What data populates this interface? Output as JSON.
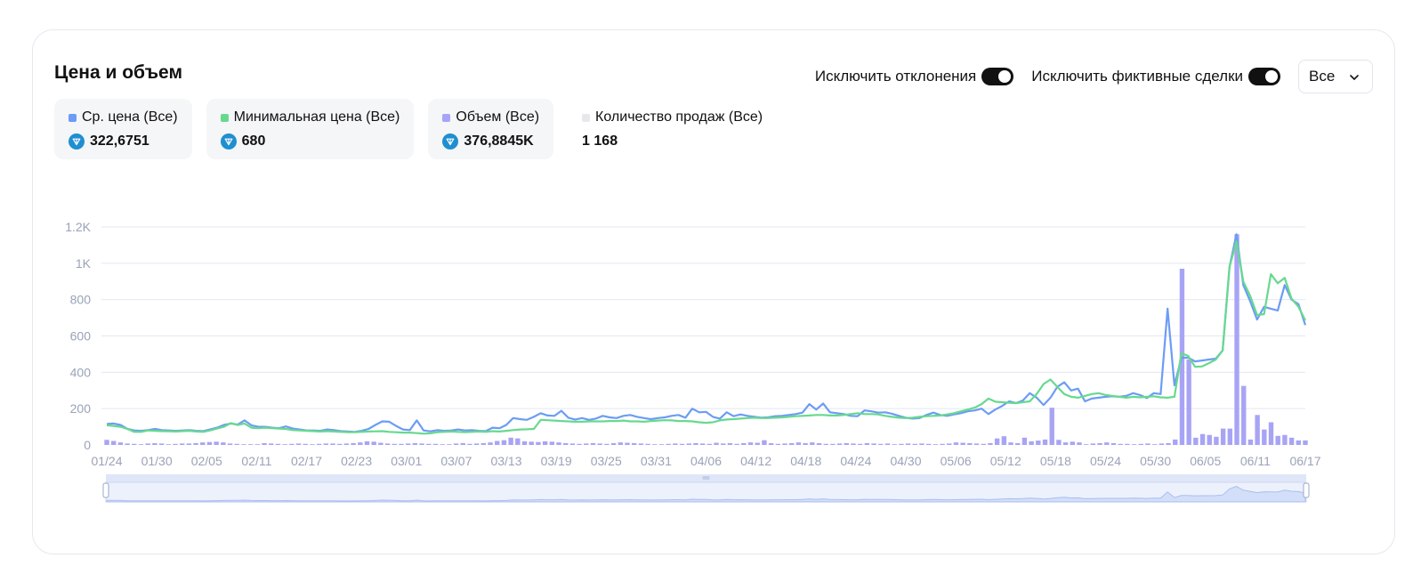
{
  "header": {
    "title": "Цена и объем"
  },
  "controls": {
    "toggle1_label": "Исключить отклонения",
    "toggle1_on": true,
    "toggle2_label": "Исключить фиктивные сделки",
    "toggle2_on": true,
    "select_value": "Все"
  },
  "stats": [
    {
      "label": "Ср. цена (Все)",
      "value": "322,6751",
      "color": "#6c9cf5",
      "icon": "ton-coin-icon"
    },
    {
      "label": "Минимальная цена (Все)",
      "value": "680",
      "color": "#67d98f",
      "icon": "ton-coin-icon"
    },
    {
      "label": "Объем (Все)",
      "value": "376,8845K",
      "color": "#a8a4f5",
      "icon": "ton-coin-icon"
    },
    {
      "label": "Количество продаж (Все)",
      "value": "1 168",
      "color": "#e8e8ec",
      "icon": ""
    }
  ],
  "colors": {
    "avg_price": "#6c9cf5",
    "min_price": "#67d98f",
    "volume": "#a8a4f5",
    "grid": "#e3e7f3",
    "axis_text": "#9aa2b8",
    "coin": "#1f8fd1"
  },
  "chart_data": {
    "type": "line",
    "ylim": [
      0,
      1200
    ],
    "y_ticks": [
      "0",
      "200",
      "400",
      "600",
      "800",
      "1K",
      "1.2K"
    ],
    "x_ticks": [
      "01/24",
      "01/30",
      "02/05",
      "02/11",
      "02/17",
      "02/23",
      "03/01",
      "03/07",
      "03/13",
      "03/19",
      "03/25",
      "03/31",
      "04/06",
      "04/12",
      "04/18",
      "04/24",
      "04/30",
      "05/06",
      "05/12",
      "05/18",
      "05/24",
      "05/30",
      "06/05",
      "06/11",
      "06/17"
    ],
    "grid": true,
    "series": [
      {
        "name": "Ср. цена (Все)",
        "kind": "line",
        "values": [
          115,
          118,
          110,
          88,
          80,
          78,
          82,
          88,
          82,
          80,
          78,
          80,
          82,
          78,
          76,
          85,
          95,
          110,
          118,
          112,
          135,
          108,
          100,
          100,
          95,
          92,
          102,
          90,
          85,
          80,
          80,
          78,
          85,
          82,
          76,
          74,
          72,
          78,
          88,
          110,
          130,
          128,
          105,
          85,
          82,
          135,
          80,
          75,
          82,
          78,
          80,
          85,
          80,
          82,
          78,
          76,
          95,
          92,
          110,
          148,
          142,
          138,
          155,
          175,
          162,
          160,
          188,
          150,
          140,
          148,
          138,
          145,
          160,
          152,
          148,
          160,
          165,
          155,
          148,
          142,
          148,
          152,
          160,
          165,
          150,
          200,
          180,
          182,
          155,
          145,
          180,
          158,
          168,
          160,
          155,
          150,
          152,
          158,
          160,
          165,
          170,
          178,
          225,
          195,
          228,
          180,
          175,
          170,
          160,
          158,
          190,
          185,
          178,
          180,
          172,
          160,
          150,
          145,
          148,
          165,
          178,
          165,
          160,
          168,
          175,
          185,
          190,
          200,
          170,
          195,
          215,
          240,
          230,
          245,
          285,
          260,
          220,
          260,
          320,
          345,
          300,
          310,
          240,
          255,
          260,
          265,
          268,
          265,
          270,
          285,
          275,
          258,
          285,
          280,
          750,
          328,
          480,
          480,
          460,
          465,
          470,
          475,
          520,
          980,
          1160,
          880,
          790,
          690,
          760,
          750,
          740,
          880,
          800,
          775,
          660
        ]
      },
      {
        "name": "Минимальная цена (Все)",
        "kind": "line",
        "values": [
          108,
          105,
          100,
          88,
          72,
          72,
          80,
          78,
          76,
          75,
          74,
          76,
          78,
          74,
          72,
          80,
          90,
          100,
          120,
          110,
          118,
          95,
          92,
          95,
          92,
          90,
          88,
          82,
          80,
          78,
          76,
          74,
          76,
          74,
          72,
          70,
          70,
          72,
          74,
          75,
          76,
          72,
          70,
          68,
          68,
          65,
          62,
          64,
          70,
          72,
          74,
          72,
          70,
          72,
          74,
          72,
          76,
          74,
          78,
          82,
          85,
          86,
          88,
          138,
          136,
          134,
          132,
          130,
          128,
          128,
          130,
          130,
          130,
          132,
          132,
          134,
          130,
          130,
          128,
          132,
          134,
          136,
          135,
          132,
          132,
          130,
          125,
          122,
          125,
          135,
          140,
          142,
          145,
          148,
          150,
          148,
          148,
          150,
          152,
          155,
          158,
          160,
          162,
          165,
          165,
          162,
          162,
          165,
          170,
          175,
          170,
          170,
          168,
          160,
          155,
          150,
          148,
          150,
          155,
          158,
          160,
          162,
          168,
          175,
          185,
          195,
          205,
          225,
          255,
          238,
          235,
          232,
          230,
          235,
          240,
          280,
          335,
          360,
          320,
          280,
          265,
          260,
          270,
          280,
          285,
          275,
          270,
          265,
          260,
          265,
          262,
          265,
          268,
          262,
          260,
          265,
          505,
          490,
          430,
          432,
          450,
          470,
          520,
          980,
          1120,
          900,
          820,
          715,
          720,
          940,
          890,
          920,
          805,
          760,
          685
        ]
      },
      {
        "name": "Объем (Все)",
        "kind": "bar",
        "values": [
          28,
          22,
          14,
          8,
          6,
          4,
          8,
          10,
          8,
          4,
          6,
          8,
          8,
          10,
          14,
          16,
          18,
          14,
          8,
          6,
          4,
          4,
          4,
          10,
          8,
          6,
          4,
          6,
          8,
          6,
          4,
          6,
          8,
          8,
          6,
          8,
          10,
          14,
          20,
          18,
          12,
          8,
          6,
          6,
          8,
          10,
          8,
          6,
          6,
          4,
          4,
          8,
          10,
          6,
          8,
          10,
          14,
          22,
          26,
          40,
          36,
          20,
          18,
          16,
          20,
          18,
          14,
          10,
          8,
          6,
          8,
          10,
          8,
          6,
          10,
          14,
          12,
          10,
          8,
          6,
          4,
          4,
          6,
          8,
          6,
          8,
          10,
          8,
          6,
          12,
          8,
          10,
          6,
          10,
          14,
          12,
          26,
          10,
          6,
          8,
          10,
          14,
          10,
          14,
          10,
          6,
          6,
          8,
          10,
          8,
          6,
          10,
          8,
          6,
          8,
          4,
          6,
          8,
          6,
          8,
          6,
          4,
          6,
          8,
          14,
          12,
          10,
          8,
          6,
          10,
          36,
          48,
          14,
          10,
          40,
          20,
          24,
          30,
          205,
          28,
          14,
          18,
          14,
          4,
          8,
          10,
          14,
          10,
          6,
          6,
          4,
          6,
          8,
          4,
          8,
          10,
          30,
          970,
          470,
          40,
          60,
          55,
          45,
          90,
          90,
          1160,
          325,
          30,
          165,
          85,
          125,
          50,
          55,
          40,
          25,
          25
        ]
      }
    ]
  }
}
